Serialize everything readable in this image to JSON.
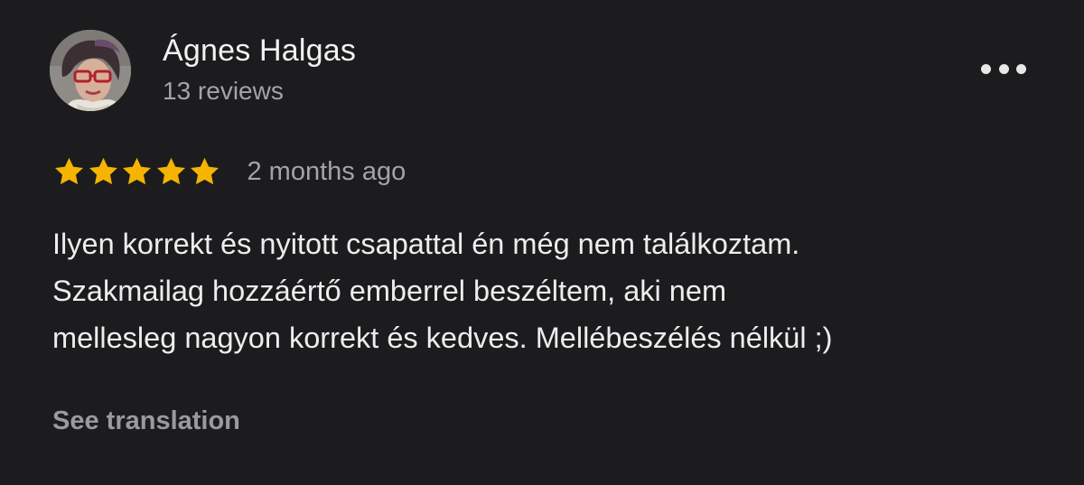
{
  "review": {
    "author": {
      "name": "Ágnes Halgas",
      "review_count": "13 reviews",
      "avatar": "profile-photo"
    },
    "more_icon": "more-horizontal-icon",
    "rating": {
      "stars": 5,
      "max": 5,
      "star_color": "#f5b400"
    },
    "date": "2 months ago",
    "text_lines": [
      "Ilyen korrekt és nyitott csapattal én még nem találkoztam.",
      "Szakmailag hozzáértő emberrel beszéltem, aki nem",
      "mellesleg nagyon korrekt és kedves. Mellébeszélés nélkül ;)"
    ],
    "see_translation": "See translation"
  },
  "theme": {
    "background": "#1c1c1e",
    "primary_text": "#ededed",
    "secondary_text": "#a3a3a8"
  }
}
